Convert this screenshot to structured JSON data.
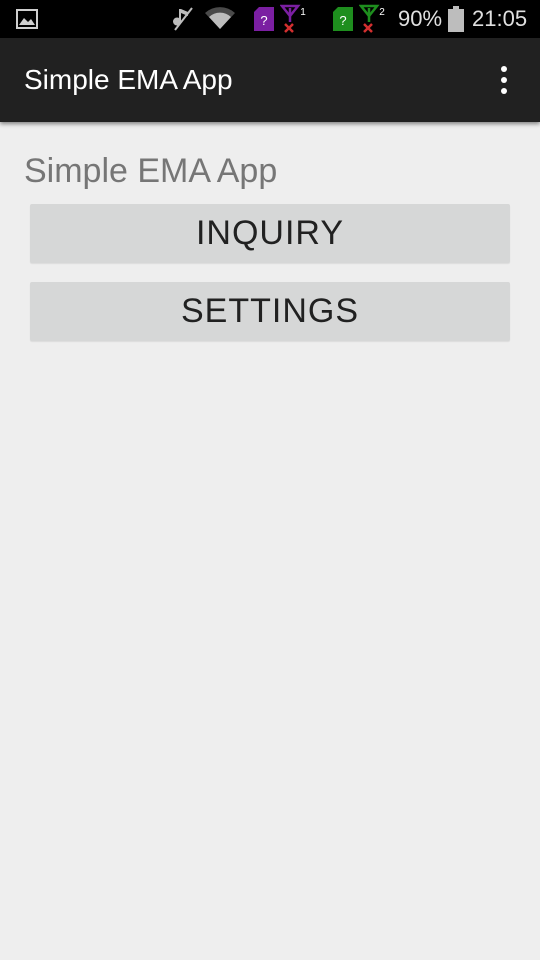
{
  "status_bar": {
    "battery_percent": "90%",
    "time": "21:05",
    "sim1_index": "1",
    "sim2_index": "2",
    "sim_unknown_mark": "?",
    "sim1_color": "#7b1fa2",
    "sim2_color": "#1e8e1e",
    "icons": [
      "image-notification-icon",
      "mute-icon",
      "wifi-icon",
      "sim1-card-icon",
      "signal1-icon",
      "sim2-card-icon",
      "signal2-icon",
      "battery-icon"
    ]
  },
  "action_bar": {
    "title": "Simple EMA App",
    "overflow_icon": "overflow-menu-icon"
  },
  "main": {
    "title": "Simple EMA App",
    "buttons": {
      "inquiry": "INQUIRY",
      "settings": "SETTINGS"
    }
  }
}
